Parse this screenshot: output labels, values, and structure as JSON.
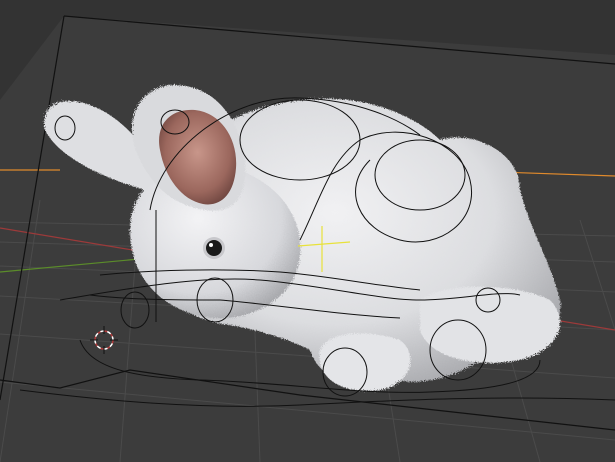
{
  "viewport": {
    "kind": "3d-viewport",
    "object": "rabbit-model",
    "shading": "rendered",
    "icons": {
      "cursor": "3d-cursor-icon",
      "pivot": "object-origin-icon"
    },
    "colors": {
      "background": "#3c3c3c",
      "floor_grid": "#4a4a4a",
      "x_axis": "#9c3a3a",
      "y_axis": "#5b8c2a",
      "orange_line": "#e08a2c",
      "fur": "#e9e9ec",
      "inner_ear": "#a06e63",
      "eye": "#1a1a1a",
      "wire": "#111111",
      "pivot": "#e8e23a",
      "cursor": "#b33a3a"
    }
  }
}
